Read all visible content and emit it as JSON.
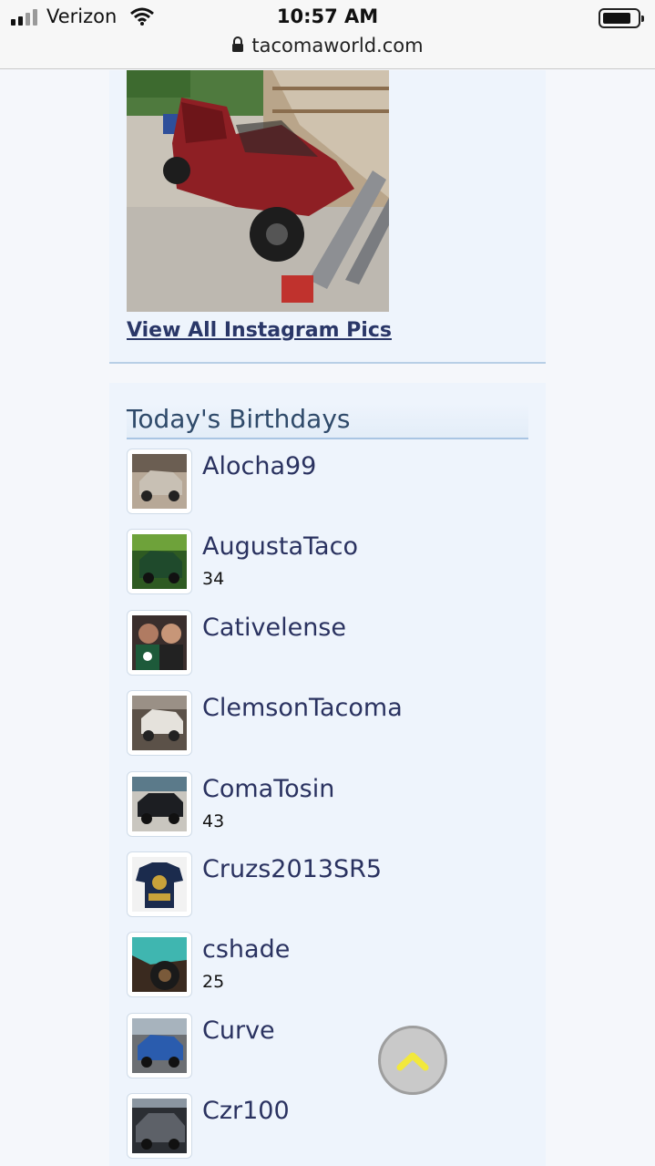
{
  "status_bar": {
    "carrier": "Verizon",
    "time": "10:57 AM",
    "url": "tacomaworld.com",
    "icons": [
      "signal-icon",
      "wifi-icon",
      "battery-icon",
      "lock-icon"
    ]
  },
  "instagram": {
    "link_label": "View All Instagram Pics"
  },
  "birthdays": {
    "title": "Today's Birthdays",
    "members": [
      {
        "name": "Alocha99",
        "age": ""
      },
      {
        "name": "AugustaTaco",
        "age": "34"
      },
      {
        "name": "Cativelense",
        "age": ""
      },
      {
        "name": "ClemsonTacoma",
        "age": ""
      },
      {
        "name": "ComaTosin",
        "age": "43"
      },
      {
        "name": "Cruzs2013SR5",
        "age": ""
      },
      {
        "name": "cshade",
        "age": "25"
      },
      {
        "name": "Curve",
        "age": ""
      },
      {
        "name": "Czr100",
        "age": ""
      }
    ]
  },
  "colors": {
    "link": "#2a3768",
    "panel_bg": "#eef4fc",
    "header_text": "#2f4a6a",
    "username": "#2a3260",
    "scroll_button_arrow": "#f2e83c"
  },
  "scroll_top_icon": "chevron-up-icon"
}
